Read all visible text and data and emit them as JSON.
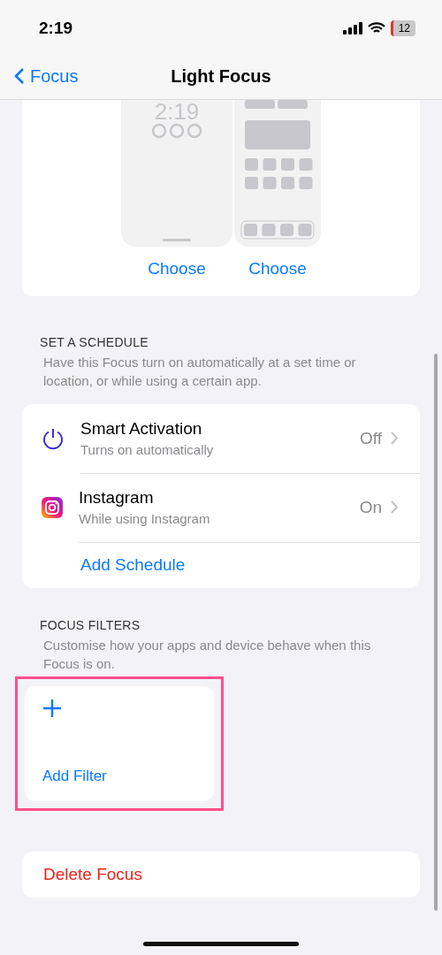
{
  "status_bar": {
    "time": "2:19",
    "battery": "12"
  },
  "nav": {
    "back": "Focus",
    "title": "Light Focus"
  },
  "wallpaper": {
    "lock_clock": "2:19",
    "choices": [
      {
        "kind": "lock",
        "action": "Choose"
      },
      {
        "kind": "home",
        "action": "Choose"
      }
    ]
  },
  "schedule": {
    "header": "SET A SCHEDULE",
    "description": "Have this Focus turn on automatically at a set time or location, or while using a certain app.",
    "rows": [
      {
        "kind": "power",
        "title": "Smart Activation",
        "subtitle": "Turns on automatically",
        "value": "Off"
      },
      {
        "kind": "instagram",
        "title": "Instagram",
        "subtitle": "While using Instagram",
        "value": "On"
      }
    ],
    "add": "Add Schedule"
  },
  "filters": {
    "header": "FOCUS FILTERS",
    "description": "Customise how your apps and device behave when this Focus is on.",
    "add": "Add Filter",
    "highlighted": true
  },
  "delete": "Delete Focus"
}
